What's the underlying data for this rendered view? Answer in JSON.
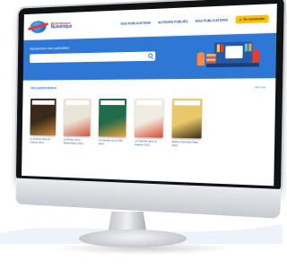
{
  "site": {
    "logo_line1": "Bibliothèque",
    "logo_line2": "Numérique"
  },
  "nav": {
    "items": [
      "NOS PUBLICATIONS",
      "AUTEURS PUBLIÉS",
      "NOS PUBLICATIONS"
    ],
    "cta_label": "Se connecter"
  },
  "hero": {
    "title": "Recherchez une publication",
    "search_placeholder": ""
  },
  "publications": {
    "title": "Nos publications",
    "see_all": "Voir tout",
    "items": [
      {
        "title": "La Gazette dans la Galaxie 2021",
        "color": "#3b2a1a",
        "accent": "#c98a3a"
      },
      {
        "title": "La Revue de la Bibliothèque 2021",
        "color": "#e9e4d8",
        "accent": "#d4553a"
      },
      {
        "title": "La Gazette de la Ville 2021",
        "color": "#1f6b4a",
        "accent": "#f2a33a"
      },
      {
        "title": "La Gazette dans la Galaxie 2021",
        "color": "#f1ece2",
        "accent": "#d9492e"
      },
      {
        "title": "Edition Spéciale Mars 2021",
        "color": "#e8c86a",
        "accent": "#3a2a12"
      }
    ]
  }
}
